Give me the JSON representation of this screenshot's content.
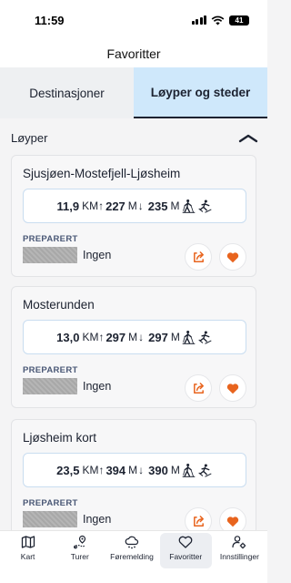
{
  "status": {
    "time": "11:59",
    "battery": "41"
  },
  "header": {
    "title": "Favoritter"
  },
  "tabs": [
    {
      "label": "Destinasjoner",
      "active": false
    },
    {
      "label": "Løyper og steder",
      "active": true
    }
  ],
  "section": {
    "label": "Løyper"
  },
  "cards": [
    {
      "name": "Sjusjøen-Mostefjell-Ljøsheim",
      "distance": "11,9",
      "distance_unit": "KM",
      "ascent": "227",
      "ascent_unit": "M",
      "descent": "235",
      "descent_unit": "M",
      "prep_label": "PREPARERT",
      "prep_value": "Ingen"
    },
    {
      "name": "Mosterunden",
      "distance": "13,0",
      "distance_unit": "KM",
      "ascent": "297",
      "ascent_unit": "M",
      "descent": "297",
      "descent_unit": "M",
      "prep_label": "PREPARERT",
      "prep_value": "Ingen"
    },
    {
      "name": "Ljøsheim kort",
      "distance": "23,5",
      "distance_unit": "KM",
      "ascent": "394",
      "ascent_unit": "M",
      "descent": "390",
      "descent_unit": "M",
      "prep_label": "PREPARERT",
      "prep_value": "Ingen"
    }
  ],
  "nav": [
    {
      "label": "Kart",
      "icon": "map-icon",
      "active": false
    },
    {
      "label": "Turer",
      "icon": "route-pin-icon",
      "active": false
    },
    {
      "label": "Føremelding",
      "icon": "snow-cloud-icon",
      "active": false
    },
    {
      "label": "Favoritter",
      "icon": "heart-icon",
      "active": true
    },
    {
      "label": "Innstillinger",
      "icon": "user-settings-icon",
      "active": false
    }
  ],
  "colors": {
    "accent": "#e8641e",
    "active_tab": "#cfe8fb",
    "text": "#1c2230"
  }
}
